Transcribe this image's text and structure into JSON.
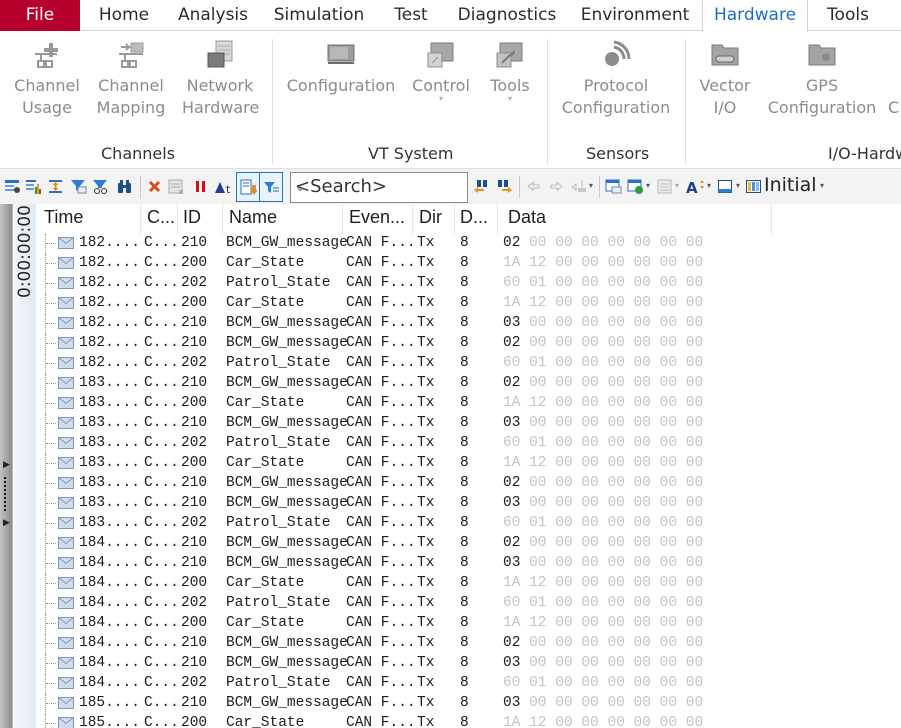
{
  "menu": {
    "tabs": [
      {
        "label": "File"
      },
      {
        "label": "Home"
      },
      {
        "label": "Analysis"
      },
      {
        "label": "Simulation"
      },
      {
        "label": "Test"
      },
      {
        "label": "Diagnostics"
      },
      {
        "label": "Environment"
      },
      {
        "label": "Hardware",
        "active": true
      },
      {
        "label": "Tools"
      }
    ]
  },
  "ribbon": {
    "groups": [
      {
        "label": "Channels",
        "buttons": [
          {
            "line1": "Channel",
            "line2": "Usage",
            "icon": "channel-usage-icon"
          },
          {
            "line1": "Channel",
            "line2": "Mapping",
            "icon": "channel-mapping-icon"
          },
          {
            "line1": "Network",
            "line2": "Hardware",
            "icon": "network-hardware-icon"
          }
        ]
      },
      {
        "label": "VT System",
        "buttons": [
          {
            "line1": "Configuration",
            "line2": "",
            "icon": "vt-configuration-icon"
          },
          {
            "line1": "Control",
            "line2": "",
            "icon": "vt-control-icon",
            "dropdown": true
          },
          {
            "line1": "Tools",
            "line2": "",
            "icon": "vt-tools-icon",
            "dropdown": true
          }
        ]
      },
      {
        "label": "Sensors",
        "buttons": [
          {
            "line1": "Protocol",
            "line2": "Configuration",
            "icon": "sensor-protocol-icon"
          }
        ]
      },
      {
        "label": "I/O-Hardw",
        "buttons": [
          {
            "line1": "Vector",
            "line2": "I/O",
            "icon": "vector-io-icon"
          },
          {
            "line1": "GPS",
            "line2": "Configuration",
            "icon": "gps-configuration-icon"
          },
          {
            "line1": "C",
            "line2": "",
            "icon": ""
          }
        ]
      }
    ]
  },
  "toolbar": {
    "search_placeholder": "<Search>",
    "layout_label": "Initial",
    "dropdown_glyph": "▾",
    "chevron_glyph": "⌄"
  },
  "timeline": {
    "time_label": "0:00:00:00"
  },
  "trace": {
    "columns": [
      "Time",
      "C...",
      "ID",
      "Name",
      "Even...",
      "Dir",
      "D...",
      "Data"
    ],
    "rows": [
      {
        "time": "182....",
        "chn": "C...",
        "id": "210",
        "name": "BCM_GW_message",
        "event": "CAN F...",
        "dir": "Tx",
        "dlc": "8",
        "data": [
          "02",
          "00",
          "00",
          "00",
          "00",
          "00",
          "00",
          "00"
        ],
        "changed": 1
      },
      {
        "time": "182....",
        "chn": "C...",
        "id": "200",
        "name": "Car_State",
        "event": "CAN F...",
        "dir": "Tx",
        "dlc": "8",
        "data": [
          "1A",
          "12",
          "00",
          "00",
          "00",
          "00",
          "00",
          "00"
        ],
        "changed": 0
      },
      {
        "time": "182....",
        "chn": "C...",
        "id": "202",
        "name": "Patrol_State",
        "event": "CAN F...",
        "dir": "Tx",
        "dlc": "8",
        "data": [
          "60",
          "01",
          "00",
          "00",
          "00",
          "00",
          "00",
          "00"
        ],
        "changed": 0
      },
      {
        "time": "182....",
        "chn": "C...",
        "id": "200",
        "name": "Car_State",
        "event": "CAN F...",
        "dir": "Tx",
        "dlc": "8",
        "data": [
          "1A",
          "12",
          "00",
          "00",
          "00",
          "00",
          "00",
          "00"
        ],
        "changed": 0
      },
      {
        "time": "182....",
        "chn": "C...",
        "id": "210",
        "name": "BCM_GW_message",
        "event": "CAN F...",
        "dir": "Tx",
        "dlc": "8",
        "data": [
          "03",
          "00",
          "00",
          "00",
          "00",
          "00",
          "00",
          "00"
        ],
        "changed": 1
      },
      {
        "time": "182....",
        "chn": "C...",
        "id": "210",
        "name": "BCM_GW_message",
        "event": "CAN F...",
        "dir": "Tx",
        "dlc": "8",
        "data": [
          "02",
          "00",
          "00",
          "00",
          "00",
          "00",
          "00",
          "00"
        ],
        "changed": 1
      },
      {
        "time": "182....",
        "chn": "C...",
        "id": "202",
        "name": "Patrol_State",
        "event": "CAN F...",
        "dir": "Tx",
        "dlc": "8",
        "data": [
          "60",
          "01",
          "00",
          "00",
          "00",
          "00",
          "00",
          "00"
        ],
        "changed": 0
      },
      {
        "time": "183....",
        "chn": "C...",
        "id": "210",
        "name": "BCM_GW_message",
        "event": "CAN F...",
        "dir": "Tx",
        "dlc": "8",
        "data": [
          "02",
          "00",
          "00",
          "00",
          "00",
          "00",
          "00",
          "00"
        ],
        "changed": 1
      },
      {
        "time": "183....",
        "chn": "C...",
        "id": "200",
        "name": "Car_State",
        "event": "CAN F...",
        "dir": "Tx",
        "dlc": "8",
        "data": [
          "1A",
          "12",
          "00",
          "00",
          "00",
          "00",
          "00",
          "00"
        ],
        "changed": 0
      },
      {
        "time": "183....",
        "chn": "C...",
        "id": "210",
        "name": "BCM_GW_message",
        "event": "CAN F...",
        "dir": "Tx",
        "dlc": "8",
        "data": [
          "03",
          "00",
          "00",
          "00",
          "00",
          "00",
          "00",
          "00"
        ],
        "changed": 1
      },
      {
        "time": "183....",
        "chn": "C...",
        "id": "202",
        "name": "Patrol_State",
        "event": "CAN F...",
        "dir": "Tx",
        "dlc": "8",
        "data": [
          "60",
          "01",
          "00",
          "00",
          "00",
          "00",
          "00",
          "00"
        ],
        "changed": 0
      },
      {
        "time": "183....",
        "chn": "C...",
        "id": "200",
        "name": "Car_State",
        "event": "CAN F...",
        "dir": "Tx",
        "dlc": "8",
        "data": [
          "1A",
          "12",
          "00",
          "00",
          "00",
          "00",
          "00",
          "00"
        ],
        "changed": 0
      },
      {
        "time": "183....",
        "chn": "C...",
        "id": "210",
        "name": "BCM_GW_message",
        "event": "CAN F...",
        "dir": "Tx",
        "dlc": "8",
        "data": [
          "02",
          "00",
          "00",
          "00",
          "00",
          "00",
          "00",
          "00"
        ],
        "changed": 1
      },
      {
        "time": "183....",
        "chn": "C...",
        "id": "210",
        "name": "BCM_GW_message",
        "event": "CAN F...",
        "dir": "Tx",
        "dlc": "8",
        "data": [
          "03",
          "00",
          "00",
          "00",
          "00",
          "00",
          "00",
          "00"
        ],
        "changed": 1
      },
      {
        "time": "183....",
        "chn": "C...",
        "id": "202",
        "name": "Patrol_State",
        "event": "CAN F...",
        "dir": "Tx",
        "dlc": "8",
        "data": [
          "60",
          "01",
          "00",
          "00",
          "00",
          "00",
          "00",
          "00"
        ],
        "changed": 0
      },
      {
        "time": "184....",
        "chn": "C...",
        "id": "210",
        "name": "BCM_GW_message",
        "event": "CAN F...",
        "dir": "Tx",
        "dlc": "8",
        "data": [
          "02",
          "00",
          "00",
          "00",
          "00",
          "00",
          "00",
          "00"
        ],
        "changed": 1
      },
      {
        "time": "184....",
        "chn": "C...",
        "id": "210",
        "name": "BCM_GW_message",
        "event": "CAN F...",
        "dir": "Tx",
        "dlc": "8",
        "data": [
          "03",
          "00",
          "00",
          "00",
          "00",
          "00",
          "00",
          "00"
        ],
        "changed": 1
      },
      {
        "time": "184....",
        "chn": "C...",
        "id": "200",
        "name": "Car_State",
        "event": "CAN F...",
        "dir": "Tx",
        "dlc": "8",
        "data": [
          "1A",
          "12",
          "00",
          "00",
          "00",
          "00",
          "00",
          "00"
        ],
        "changed": 0
      },
      {
        "time": "184....",
        "chn": "C...",
        "id": "202",
        "name": "Patrol_State",
        "event": "CAN F...",
        "dir": "Tx",
        "dlc": "8",
        "data": [
          "60",
          "01",
          "00",
          "00",
          "00",
          "00",
          "00",
          "00"
        ],
        "changed": 0
      },
      {
        "time": "184....",
        "chn": "C...",
        "id": "200",
        "name": "Car_State",
        "event": "CAN F...",
        "dir": "Tx",
        "dlc": "8",
        "data": [
          "1A",
          "12",
          "00",
          "00",
          "00",
          "00",
          "00",
          "00"
        ],
        "changed": 0
      },
      {
        "time": "184....",
        "chn": "C...",
        "id": "210",
        "name": "BCM_GW_message",
        "event": "CAN F...",
        "dir": "Tx",
        "dlc": "8",
        "data": [
          "02",
          "00",
          "00",
          "00",
          "00",
          "00",
          "00",
          "00"
        ],
        "changed": 1
      },
      {
        "time": "184....",
        "chn": "C...",
        "id": "210",
        "name": "BCM_GW_message",
        "event": "CAN F...",
        "dir": "Tx",
        "dlc": "8",
        "data": [
          "03",
          "00",
          "00",
          "00",
          "00",
          "00",
          "00",
          "00"
        ],
        "changed": 1
      },
      {
        "time": "184....",
        "chn": "C...",
        "id": "202",
        "name": "Patrol_State",
        "event": "CAN F...",
        "dir": "Tx",
        "dlc": "8",
        "data": [
          "60",
          "01",
          "00",
          "00",
          "00",
          "00",
          "00",
          "00"
        ],
        "changed": 0
      },
      {
        "time": "185....",
        "chn": "C...",
        "id": "210",
        "name": "BCM_GW_message",
        "event": "CAN F...",
        "dir": "Tx",
        "dlc": "8",
        "data": [
          "03",
          "00",
          "00",
          "00",
          "00",
          "00",
          "00",
          "00"
        ],
        "changed": 1
      },
      {
        "time": "185....",
        "chn": "C...",
        "id": "200",
        "name": "Car_State",
        "event": "CAN F...",
        "dir": "Tx",
        "dlc": "8",
        "data": [
          "1A",
          "12",
          "00",
          "00",
          "00",
          "00",
          "00",
          "00"
        ],
        "changed": 0
      }
    ]
  },
  "colors": {
    "file_tab": "#b5002b",
    "active_tab_text": "#1a6fc2",
    "toggle_border": "#1e73c8",
    "data_changed": "#1c1c1c",
    "data_unchanged": "#c4c4c4"
  }
}
